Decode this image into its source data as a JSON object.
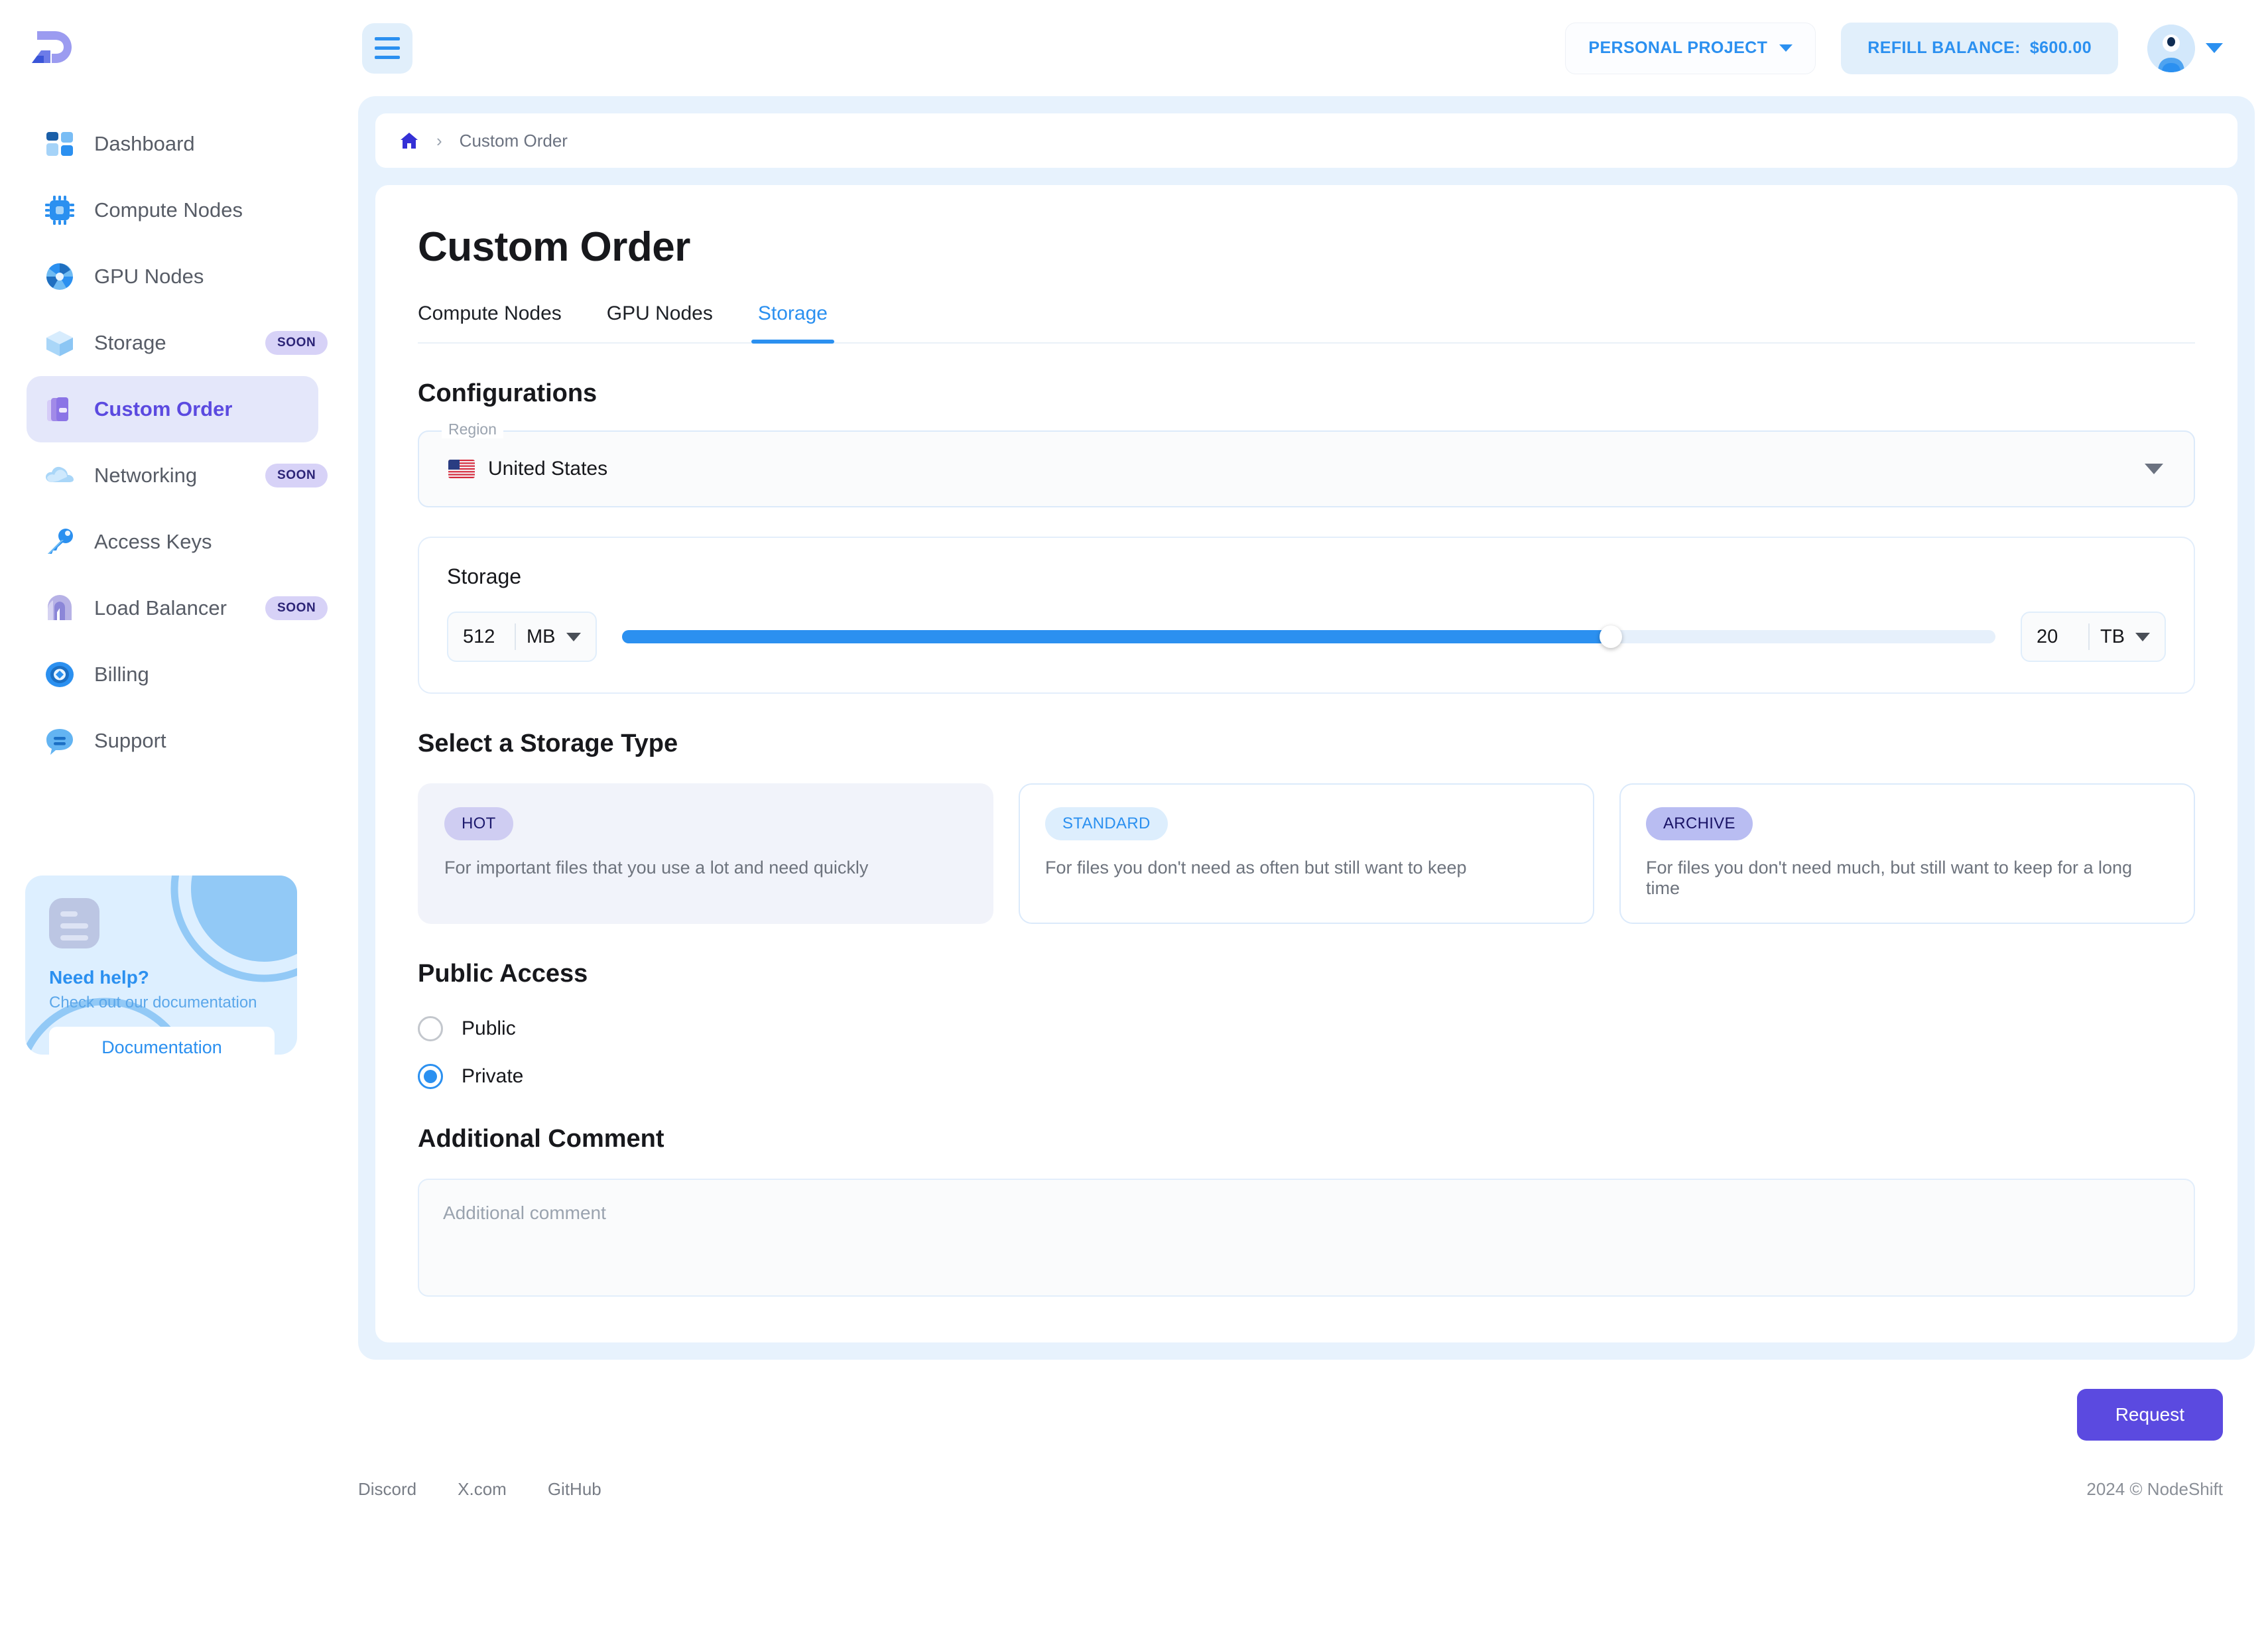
{
  "brand": {
    "logo_name": "nodeshift-logo"
  },
  "sidebar": {
    "items": [
      {
        "label": "Dashboard",
        "icon": "dashboard-icon",
        "badge": null,
        "active": false
      },
      {
        "label": "Compute Nodes",
        "icon": "cpu-icon",
        "badge": null,
        "active": false
      },
      {
        "label": "GPU Nodes",
        "icon": "gpu-icon",
        "badge": null,
        "active": false
      },
      {
        "label": "Storage",
        "icon": "cube-icon",
        "badge": "SOON",
        "active": false
      },
      {
        "label": "Custom Order",
        "icon": "custom-order-icon",
        "badge": null,
        "active": true
      },
      {
        "label": "Networking",
        "icon": "cloud-icon",
        "badge": "SOON",
        "active": false
      },
      {
        "label": "Access Keys",
        "icon": "key-icon",
        "badge": null,
        "active": false
      },
      {
        "label": "Load Balancer",
        "icon": "load-balancer-icon",
        "badge": "SOON",
        "active": false
      },
      {
        "label": "Billing",
        "icon": "billing-icon",
        "badge": null,
        "active": false
      },
      {
        "label": "Support",
        "icon": "support-chat-icon",
        "badge": null,
        "active": false
      }
    ],
    "help_card": {
      "title": "Need help?",
      "subtitle": "Check out our documentation",
      "button_label": "Documentation",
      "icon": "document-icon"
    }
  },
  "topbar": {
    "menu_icon": "hamburger-icon",
    "project_label": "PERSONAL PROJECT",
    "refill_label": "REFILL BALANCE:",
    "refill_amount": "$600.00",
    "avatar_icon": "user-avatar-icon"
  },
  "breadcrumb": {
    "home_icon": "home-icon",
    "separator": "›",
    "current": "Custom Order"
  },
  "page": {
    "title": "Custom Order"
  },
  "tabs": [
    {
      "label": "Compute Nodes",
      "active": false
    },
    {
      "label": "GPU Nodes",
      "active": false
    },
    {
      "label": "Storage",
      "active": true
    }
  ],
  "configurations": {
    "heading": "Configurations",
    "region": {
      "legend": "Region",
      "value": "United States",
      "flag_icon": "us-flag-icon",
      "caret_icon": "dropdown-caret-icon"
    }
  },
  "storage": {
    "label": "Storage",
    "min_value": "512",
    "min_unit": "MB",
    "max_value": "20",
    "max_unit": "TB",
    "slider_percent": 72
  },
  "storage_type": {
    "heading": "Select a Storage Type",
    "options": [
      {
        "tag": "HOT",
        "description": "For important files that you use a lot and need quickly",
        "selected": true
      },
      {
        "tag": "STANDARD",
        "description": "For files you don't need as often but still want to keep",
        "selected": false
      },
      {
        "tag": "ARCHIVE",
        "description": "For files you don't need much, but still want to keep for a long time",
        "selected": false
      }
    ]
  },
  "public_access": {
    "heading": "Public Access",
    "options": [
      {
        "label": "Public",
        "checked": false
      },
      {
        "label": "Private",
        "checked": true
      }
    ]
  },
  "additional_comment": {
    "heading": "Additional Comment",
    "placeholder": "Additional comment",
    "value": ""
  },
  "actions": {
    "request_label": "Request"
  },
  "footer": {
    "links": [
      "Discord",
      "X.com",
      "GitHub"
    ],
    "copyright": "2024 © NodeShift"
  },
  "colors": {
    "accent_blue": "#2b90f0",
    "accent_purple": "#5b4ae0",
    "page_bg": "#e7f2fd",
    "sidebar_active_bg": "#e4e7fa"
  }
}
